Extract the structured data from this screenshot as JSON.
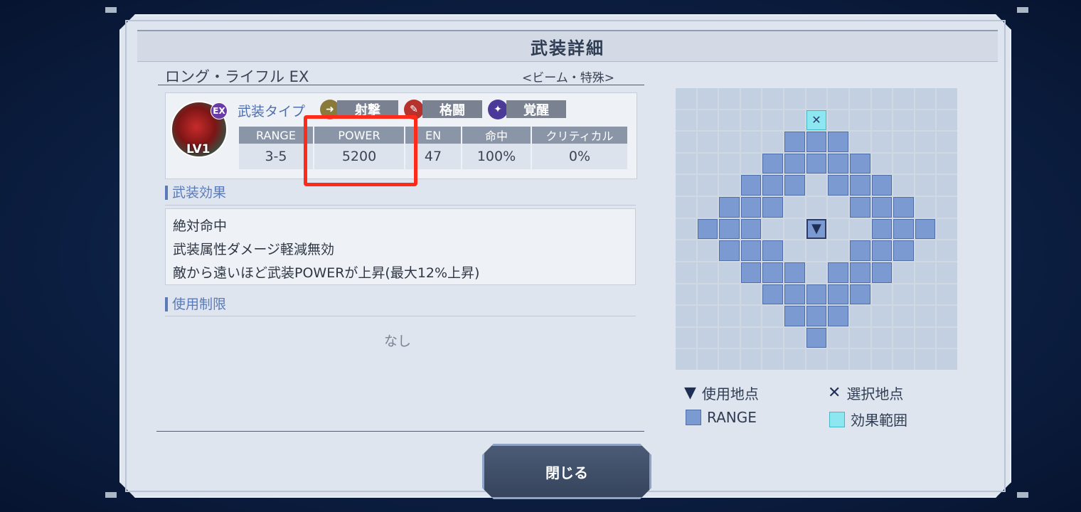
{
  "dialog": {
    "title": "武装詳細",
    "weapon_name": "ロング・ライフル EX",
    "weapon_attribute": "<ビーム・特殊>"
  },
  "unit": {
    "level": "LV1",
    "badge": "EX",
    "icon": "unit-portrait-icon"
  },
  "weapon_type": {
    "label": "武装タイプ",
    "types": [
      {
        "label": "射撃",
        "icon": "shooting-icon",
        "color": "#8a7a3a"
      },
      {
        "label": "格闘",
        "icon": "melee-icon",
        "color": "#b8322d"
      },
      {
        "label": "覚醒",
        "icon": "awakening-icon",
        "color": "#4b3a98"
      }
    ]
  },
  "stats": {
    "headers": [
      "RANGE",
      "POWER",
      "EN",
      "命中",
      "クリティカル"
    ],
    "values": [
      "3-5",
      "5200",
      "47",
      "100%",
      "0%"
    ],
    "highlighted": "POWER"
  },
  "effects": {
    "title": "武装効果",
    "lines": [
      "絶対命中",
      "武装属性ダメージ軽減無効",
      "敵から遠いほど武装POWERが上昇(最大12%上昇)"
    ]
  },
  "restrictions": {
    "title": "使用制限",
    "value": "なし"
  },
  "range_grid": {
    "rows": 13,
    "cols": 13,
    "user_cell": [
      6,
      6
    ],
    "effect_cells": [
      [
        1,
        6
      ]
    ],
    "range_cells": [
      [
        2,
        5
      ],
      [
        2,
        6
      ],
      [
        2,
        7
      ],
      [
        3,
        4
      ],
      [
        3,
        5
      ],
      [
        3,
        6
      ],
      [
        3,
        7
      ],
      [
        3,
        8
      ],
      [
        4,
        3
      ],
      [
        4,
        4
      ],
      [
        4,
        5
      ],
      [
        4,
        7
      ],
      [
        4,
        8
      ],
      [
        4,
        9
      ],
      [
        5,
        2
      ],
      [
        5,
        3
      ],
      [
        5,
        4
      ],
      [
        5,
        8
      ],
      [
        5,
        9
      ],
      [
        5,
        10
      ],
      [
        6,
        1
      ],
      [
        6,
        2
      ],
      [
        6,
        3
      ],
      [
        6,
        9
      ],
      [
        6,
        10
      ],
      [
        6,
        11
      ],
      [
        7,
        2
      ],
      [
        7,
        3
      ],
      [
        7,
        4
      ],
      [
        7,
        8
      ],
      [
        7,
        9
      ],
      [
        7,
        10
      ],
      [
        8,
        3
      ],
      [
        8,
        4
      ],
      [
        8,
        5
      ],
      [
        8,
        7
      ],
      [
        8,
        8
      ],
      [
        8,
        9
      ],
      [
        9,
        4
      ],
      [
        9,
        5
      ],
      [
        9,
        6
      ],
      [
        9,
        7
      ],
      [
        9,
        8
      ],
      [
        10,
        5
      ],
      [
        10,
        6
      ],
      [
        10,
        7
      ],
      [
        11,
        6
      ]
    ]
  },
  "legend": {
    "use_point": "使用地点",
    "select_point": "選択地点",
    "range": "RANGE",
    "effect_area": "効果範囲"
  },
  "close_label": "閉じる"
}
